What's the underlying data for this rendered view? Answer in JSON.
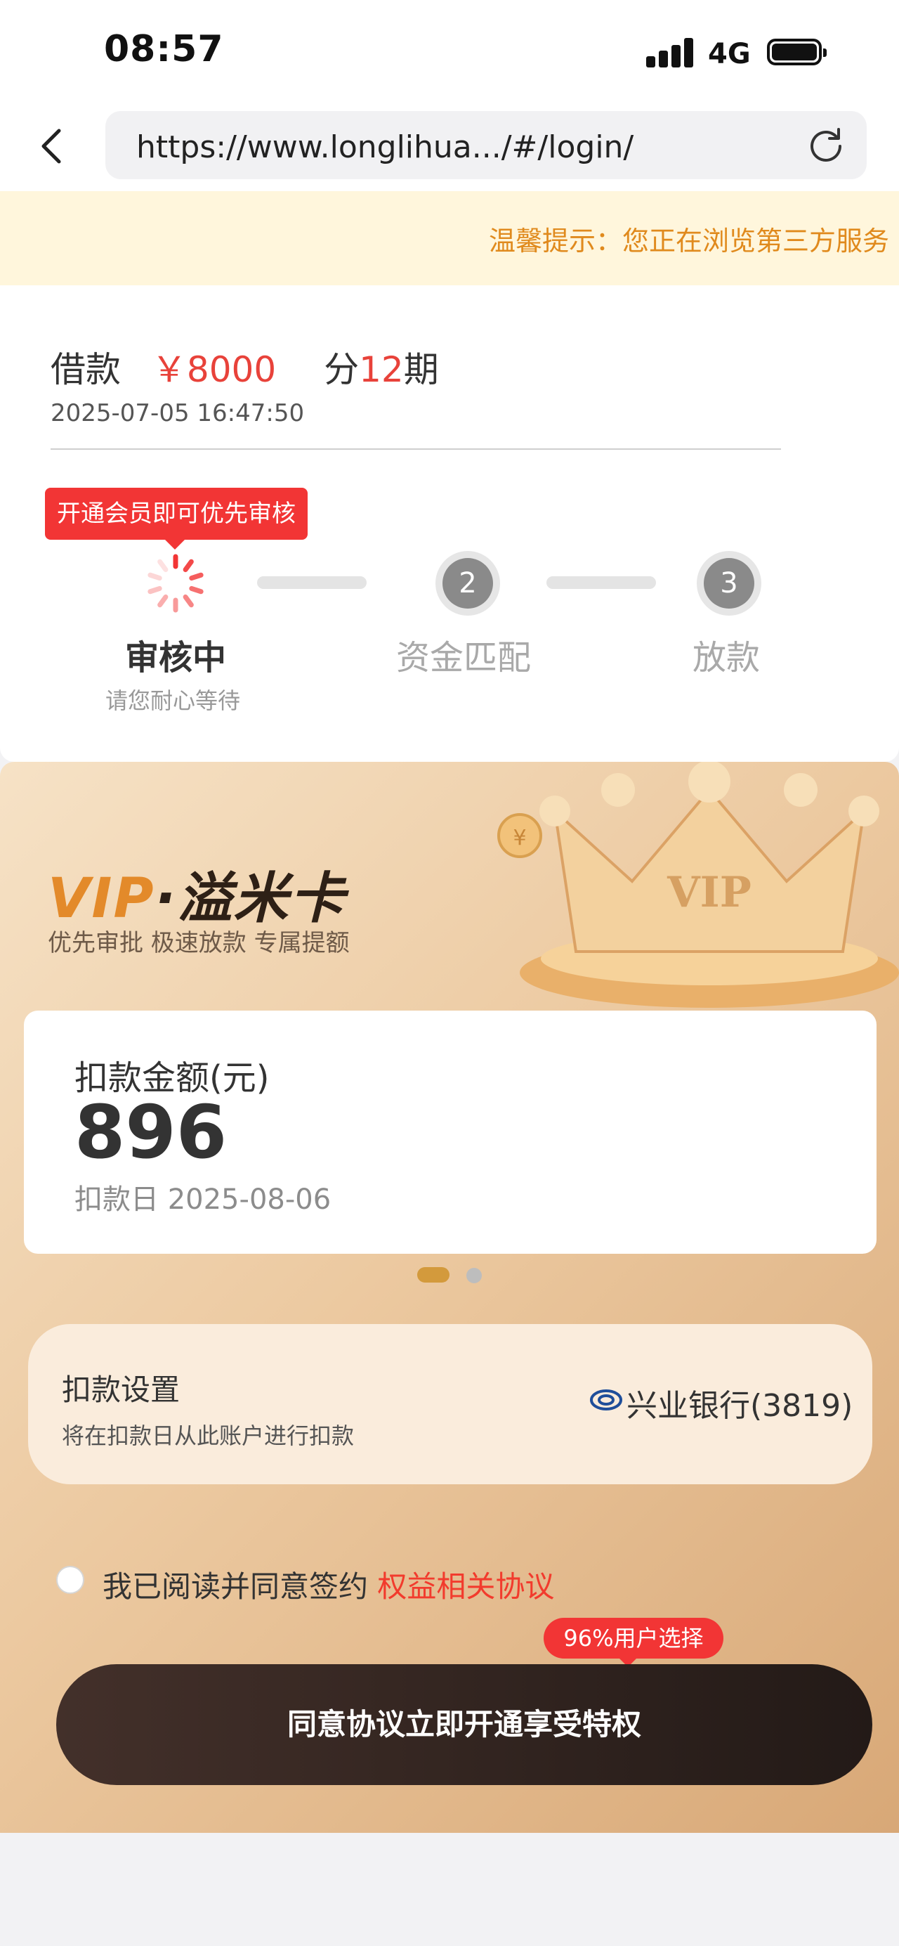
{
  "status_bar": {
    "time": "08:57",
    "network": "4G"
  },
  "browser": {
    "url": "https://www.longlihua.../#/login/"
  },
  "notice": {
    "text": "温馨提示：您正在浏览第三方服务"
  },
  "loan": {
    "label": "借款",
    "amount": "￥8000",
    "term_prefix": "分",
    "term_count": "12",
    "term_suffix": "期",
    "datetime": "2025-07-05 16:47:50"
  },
  "progress": {
    "tip": "开通会员即可优先审核",
    "steps": [
      {
        "title": "审核中",
        "subtitle": "请您耐心等待"
      },
      {
        "number": "2",
        "title": "资金匹配"
      },
      {
        "number": "3",
        "title": "放款"
      }
    ]
  },
  "vip": {
    "logo_vip": "VIP",
    "logo_name": "·溢米卡",
    "tagline": "优先审批 极速放款 专属提额",
    "crown_text": "VIP"
  },
  "deduction": {
    "amount_label": "扣款金额(元)",
    "amount": "896",
    "date_label": "扣款日 2025-08-06"
  },
  "setting": {
    "title": "扣款设置",
    "subtitle": "将在扣款日从此账户进行扣款",
    "bank": "兴业银行(3819)"
  },
  "agreement": {
    "text": "我已阅读并同意签约",
    "link": "权益相关协议"
  },
  "cta": {
    "badge": "96%用户选择",
    "label": "同意协议立即开通享受特权"
  },
  "colors": {
    "accent_red": "#f23535",
    "gold": "#d39a3c",
    "cta_dark": "#2b201c"
  }
}
